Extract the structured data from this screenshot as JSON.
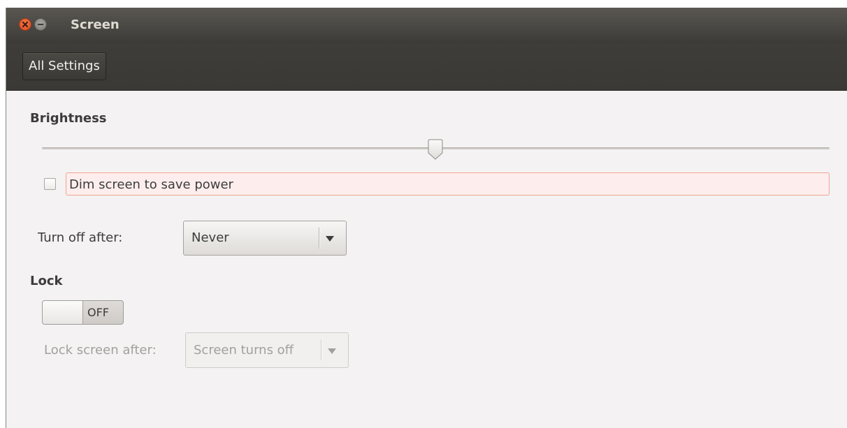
{
  "window": {
    "title": "Screen"
  },
  "toolbar": {
    "all_settings_label": "All Settings"
  },
  "brightness": {
    "heading": "Brightness",
    "level_fraction": 0.5,
    "dim_checkbox_label": "Dim screen to save power",
    "dim_checked": false
  },
  "turn_off": {
    "label": "Turn off after:",
    "selected": "Never"
  },
  "lock": {
    "heading": "Lock",
    "switch_state": "OFF",
    "lock_after_label": "Lock screen after:",
    "lock_after_selected": "Screen turns off"
  },
  "icons": {
    "close": "close-icon",
    "minimize": "minimize-icon",
    "dropdown": "chevron-down-icon"
  },
  "colors": {
    "titlebar": "#3c3b37",
    "close_button": "#e05a2b",
    "focus_highlight": "#f0a591"
  }
}
